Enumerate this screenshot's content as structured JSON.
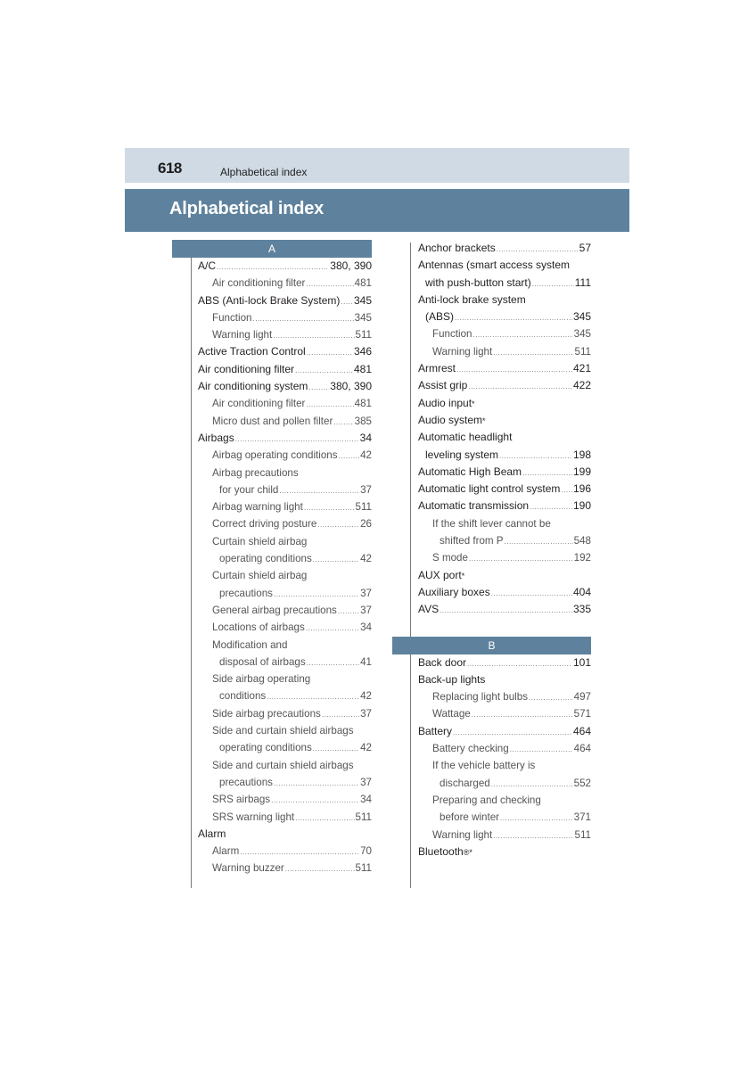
{
  "header": {
    "page_number": "618",
    "running_head": "Alphabetical index",
    "title": "Alphabetical index"
  },
  "sections": {
    "A": {
      "letter": "A",
      "left_column": [
        {
          "label": "A/C",
          "page": "380, 390",
          "level": 0
        },
        {
          "label": "Air conditioning filter",
          "page": "481",
          "level": 1
        },
        {
          "label": "ABS (Anti-lock Brake System)",
          "page": "345",
          "level": 0
        },
        {
          "label": "Function",
          "page": "345",
          "level": 1
        },
        {
          "label": "Warning light",
          "page": "511",
          "level": 1
        },
        {
          "label": "Active Traction Control",
          "page": "346",
          "level": 0
        },
        {
          "label": "Air conditioning filter",
          "page": "481",
          "level": 0
        },
        {
          "label": "Air conditioning system",
          "page": "380, 390",
          "level": 0
        },
        {
          "label": "Air conditioning filter",
          "page": "481",
          "level": 1
        },
        {
          "label": "Micro dust and pollen filter",
          "page": "385",
          "level": 1
        },
        {
          "label": "Airbags",
          "page": "34",
          "level": 0
        },
        {
          "label": "Airbag operating conditions",
          "page": "42",
          "level": 1
        },
        {
          "label": "Airbag precautions",
          "page": "",
          "level": 1
        },
        {
          "label": "for your child",
          "page": "37",
          "level": 2
        },
        {
          "label": "Airbag warning light",
          "page": "511",
          "level": 1
        },
        {
          "label": "Correct driving posture",
          "page": "26",
          "level": 1
        },
        {
          "label": "Curtain shield airbag",
          "page": "",
          "level": 1
        },
        {
          "label": "operating conditions",
          "page": "42",
          "level": 2
        },
        {
          "label": "Curtain shield airbag",
          "page": "",
          "level": 1
        },
        {
          "label": "precautions",
          "page": "37",
          "level": 2
        },
        {
          "label": "General airbag precautions",
          "page": "37",
          "level": 1
        },
        {
          "label": "Locations of airbags",
          "page": "34",
          "level": 1
        },
        {
          "label": "Modification and",
          "page": "",
          "level": 1
        },
        {
          "label": "disposal of airbags",
          "page": "41",
          "level": 2
        },
        {
          "label": "Side airbag operating",
          "page": "",
          "level": 1
        },
        {
          "label": "conditions",
          "page": "42",
          "level": 2
        },
        {
          "label": "Side airbag precautions",
          "page": "37",
          "level": 1
        },
        {
          "label": "Side and curtain shield airbags",
          "page": "",
          "level": 1
        },
        {
          "label": "operating conditions",
          "page": "42",
          "level": 2
        },
        {
          "label": "Side and curtain shield airbags",
          "page": "",
          "level": 1
        },
        {
          "label": "precautions",
          "page": "37",
          "level": 2
        },
        {
          "label": "SRS airbags",
          "page": "34",
          "level": 1
        },
        {
          "label": "SRS warning light",
          "page": "511",
          "level": 1
        },
        {
          "label": "Alarm",
          "page": "",
          "level": 0
        },
        {
          "label": "Alarm",
          "page": "70",
          "level": 1
        },
        {
          "label": "Warning buzzer",
          "page": "511",
          "level": 1
        }
      ],
      "right_column": [
        {
          "label": "Anchor brackets",
          "page": "57",
          "level": 0
        },
        {
          "label": "Antennas (smart access system",
          "page": "",
          "level": 0
        },
        {
          "label": "with push-button start)",
          "page": "111",
          "level": 3
        },
        {
          "label": "Anti-lock brake system",
          "page": "",
          "level": 0
        },
        {
          "label": "(ABS)",
          "page": "345",
          "level": 3
        },
        {
          "label": "Function",
          "page": "345",
          "level": 1
        },
        {
          "label": "Warning light",
          "page": "511",
          "level": 1
        },
        {
          "label": "Armrest",
          "page": "421",
          "level": 0
        },
        {
          "label": "Assist grip",
          "page": "422",
          "level": 0
        },
        {
          "label": "Audio input",
          "page": "",
          "level": 0,
          "mark": "*"
        },
        {
          "label": "Audio system",
          "page": "",
          "level": 0,
          "mark": "*"
        },
        {
          "label": "Automatic headlight",
          "page": "",
          "level": 0
        },
        {
          "label": "leveling system",
          "page": "198",
          "level": 3
        },
        {
          "label": "Automatic High Beam",
          "page": "199",
          "level": 0
        },
        {
          "label": "Automatic light control system",
          "page": "196",
          "level": 0
        },
        {
          "label": "Automatic transmission",
          "page": "190",
          "level": 0
        },
        {
          "label": "If the shift lever cannot be",
          "page": "",
          "level": 1
        },
        {
          "label": "shifted from P",
          "page": "548",
          "level": 2
        },
        {
          "label": "S mode",
          "page": "192",
          "level": 1
        },
        {
          "label": "AUX port",
          "page": "",
          "level": 0,
          "mark": "*"
        },
        {
          "label": "Auxiliary boxes",
          "page": "404",
          "level": 0
        },
        {
          "label": "AVS",
          "page": "335",
          "level": 0
        }
      ]
    },
    "B": {
      "letter": "B",
      "entries": [
        {
          "label": "Back door",
          "page": "101",
          "level": 0
        },
        {
          "label": "Back-up lights",
          "page": "",
          "level": 0
        },
        {
          "label": "Replacing light bulbs",
          "page": "497",
          "level": 1
        },
        {
          "label": "Wattage",
          "page": "571",
          "level": 1
        },
        {
          "label": "Battery",
          "page": "464",
          "level": 0
        },
        {
          "label": "Battery checking",
          "page": "464",
          "level": 1
        },
        {
          "label": "If the vehicle battery is",
          "page": "",
          "level": 1
        },
        {
          "label": "discharged",
          "page": "552",
          "level": 2
        },
        {
          "label": "Preparing and checking",
          "page": "",
          "level": 1
        },
        {
          "label": "before winter",
          "page": "371",
          "level": 2
        },
        {
          "label": "Warning light",
          "page": "511",
          "level": 1
        },
        {
          "label": "Bluetooth",
          "page": "",
          "level": 0,
          "mark": "®*"
        }
      ]
    }
  },
  "colors": {
    "header_band": "#cfdae4",
    "title_band": "#5e829d",
    "letter_band": "#5e829d"
  }
}
